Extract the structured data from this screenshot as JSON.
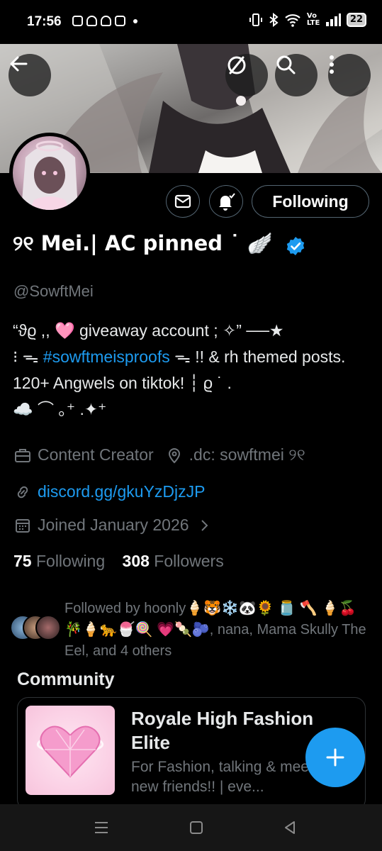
{
  "status_bar": {
    "time": "17:56",
    "network": "Vo LTE",
    "battery": "22",
    "icons": [
      "instagram-icon",
      "snapchat-icon",
      "snapchat-icon",
      "instagram-icon",
      "notification-dot",
      "vibrate-icon",
      "bluetooth-icon",
      "wifi-icon",
      "signal-icon",
      "battery-icon"
    ]
  },
  "header": {
    "back_icon": "arrow-left-icon",
    "actions": [
      "no-entry-icon",
      "search-icon",
      "more-vertical-icon"
    ]
  },
  "profile": {
    "name": "୨୧ Mei.| AC pinned ˙ 🪽",
    "handle": "@SowftMei",
    "verified_color": "#1d9bf0",
    "follow_button": "Following",
    "bio_part1": "“ϑϱ ,, 🩷 giveaway account ; ✧” ──★",
    "bio_part2": "⁝ ᯓ ",
    "bio_hashtag": "#sowftmeisproofs",
    "bio_part3": " ᯓ !! & rh themed posts.  120+ Angwels on tiktok! ┆ ϱ ˙ .",
    "bio_part4": "☁️   ⌒  ｡⁺   .✦⁺",
    "category": "Content Creator",
    "location": ".dc: sowftmei ୨୧",
    "link": "discord.gg/gkuYzDjzJP",
    "joined": "Joined January 2026"
  },
  "stats": {
    "following_count": "75",
    "following_label": "Following",
    "followers_count": "308",
    "followers_label": "Followers"
  },
  "followed_by": {
    "text": "Followed by hoonly🍦🐯❄️🐼🌻 🫙 🪓 🍦🍒🎋🍦🐆🍧🍭 💗🍡🫐, nana, Mama Skully The Eel, and 4 others"
  },
  "community": {
    "heading": "Community",
    "title": "Royale High Fashion Elite",
    "description": "For Fashion, talking & meeting new friends!! | eve..."
  },
  "colors": {
    "accent": "#1d9bf0",
    "background": "#000000",
    "muted_text": "#71767b"
  }
}
